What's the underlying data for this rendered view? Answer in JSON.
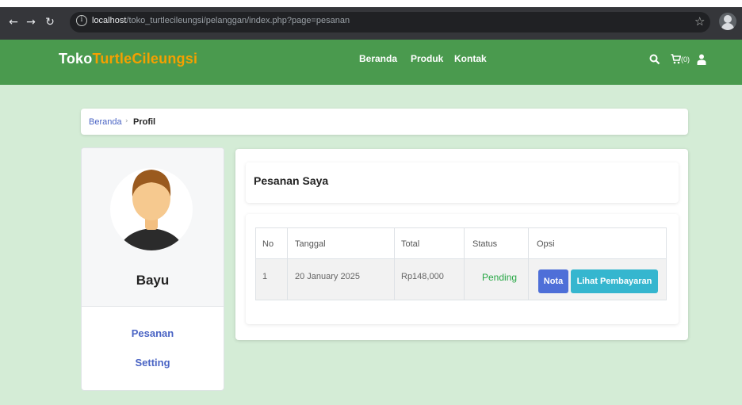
{
  "browser": {
    "url_host": "localhost",
    "url_path": "/toko_turtlecileungsi/pelanggan/index.php?page=pesanan",
    "back_icon": "arrow-left-icon",
    "forward_icon": "arrow-right-icon",
    "reload_icon": "reload-icon",
    "info_icon": "info-icon",
    "bookmark_icon": "star-icon",
    "profile_icon": "profile-icon"
  },
  "navbar": {
    "brand_part1": "Toko",
    "brand_part2": "TurtleCileungsi",
    "menu": [
      "Beranda",
      "Produk",
      "Kontak"
    ],
    "cart_count": "(0)",
    "colors": {
      "bar": "#4a9a4e",
      "brand_accent": "#f5a000"
    }
  },
  "breadcrumb": {
    "home": "Beranda",
    "separator": "›",
    "current": "Profil"
  },
  "profile": {
    "name": "Bayu",
    "links": [
      "Pesanan",
      "Setting"
    ]
  },
  "orders": {
    "title": "Pesanan Saya",
    "columns": [
      "No",
      "Tanggal",
      "Total",
      "Status",
      "Opsi"
    ],
    "rows": [
      {
        "no": "1",
        "tanggal": "20 January 2025",
        "total": "Rp148,000",
        "status": "Pending",
        "actions": [
          "Nota",
          "Lihat Pembayaran"
        ]
      }
    ]
  },
  "colors": {
    "page_bg": "#d4ecd6",
    "link": "#4a64c4",
    "status_pending": "#28a745",
    "btn_nota": "#4e6fd8",
    "btn_bayar": "#35b6cf"
  }
}
